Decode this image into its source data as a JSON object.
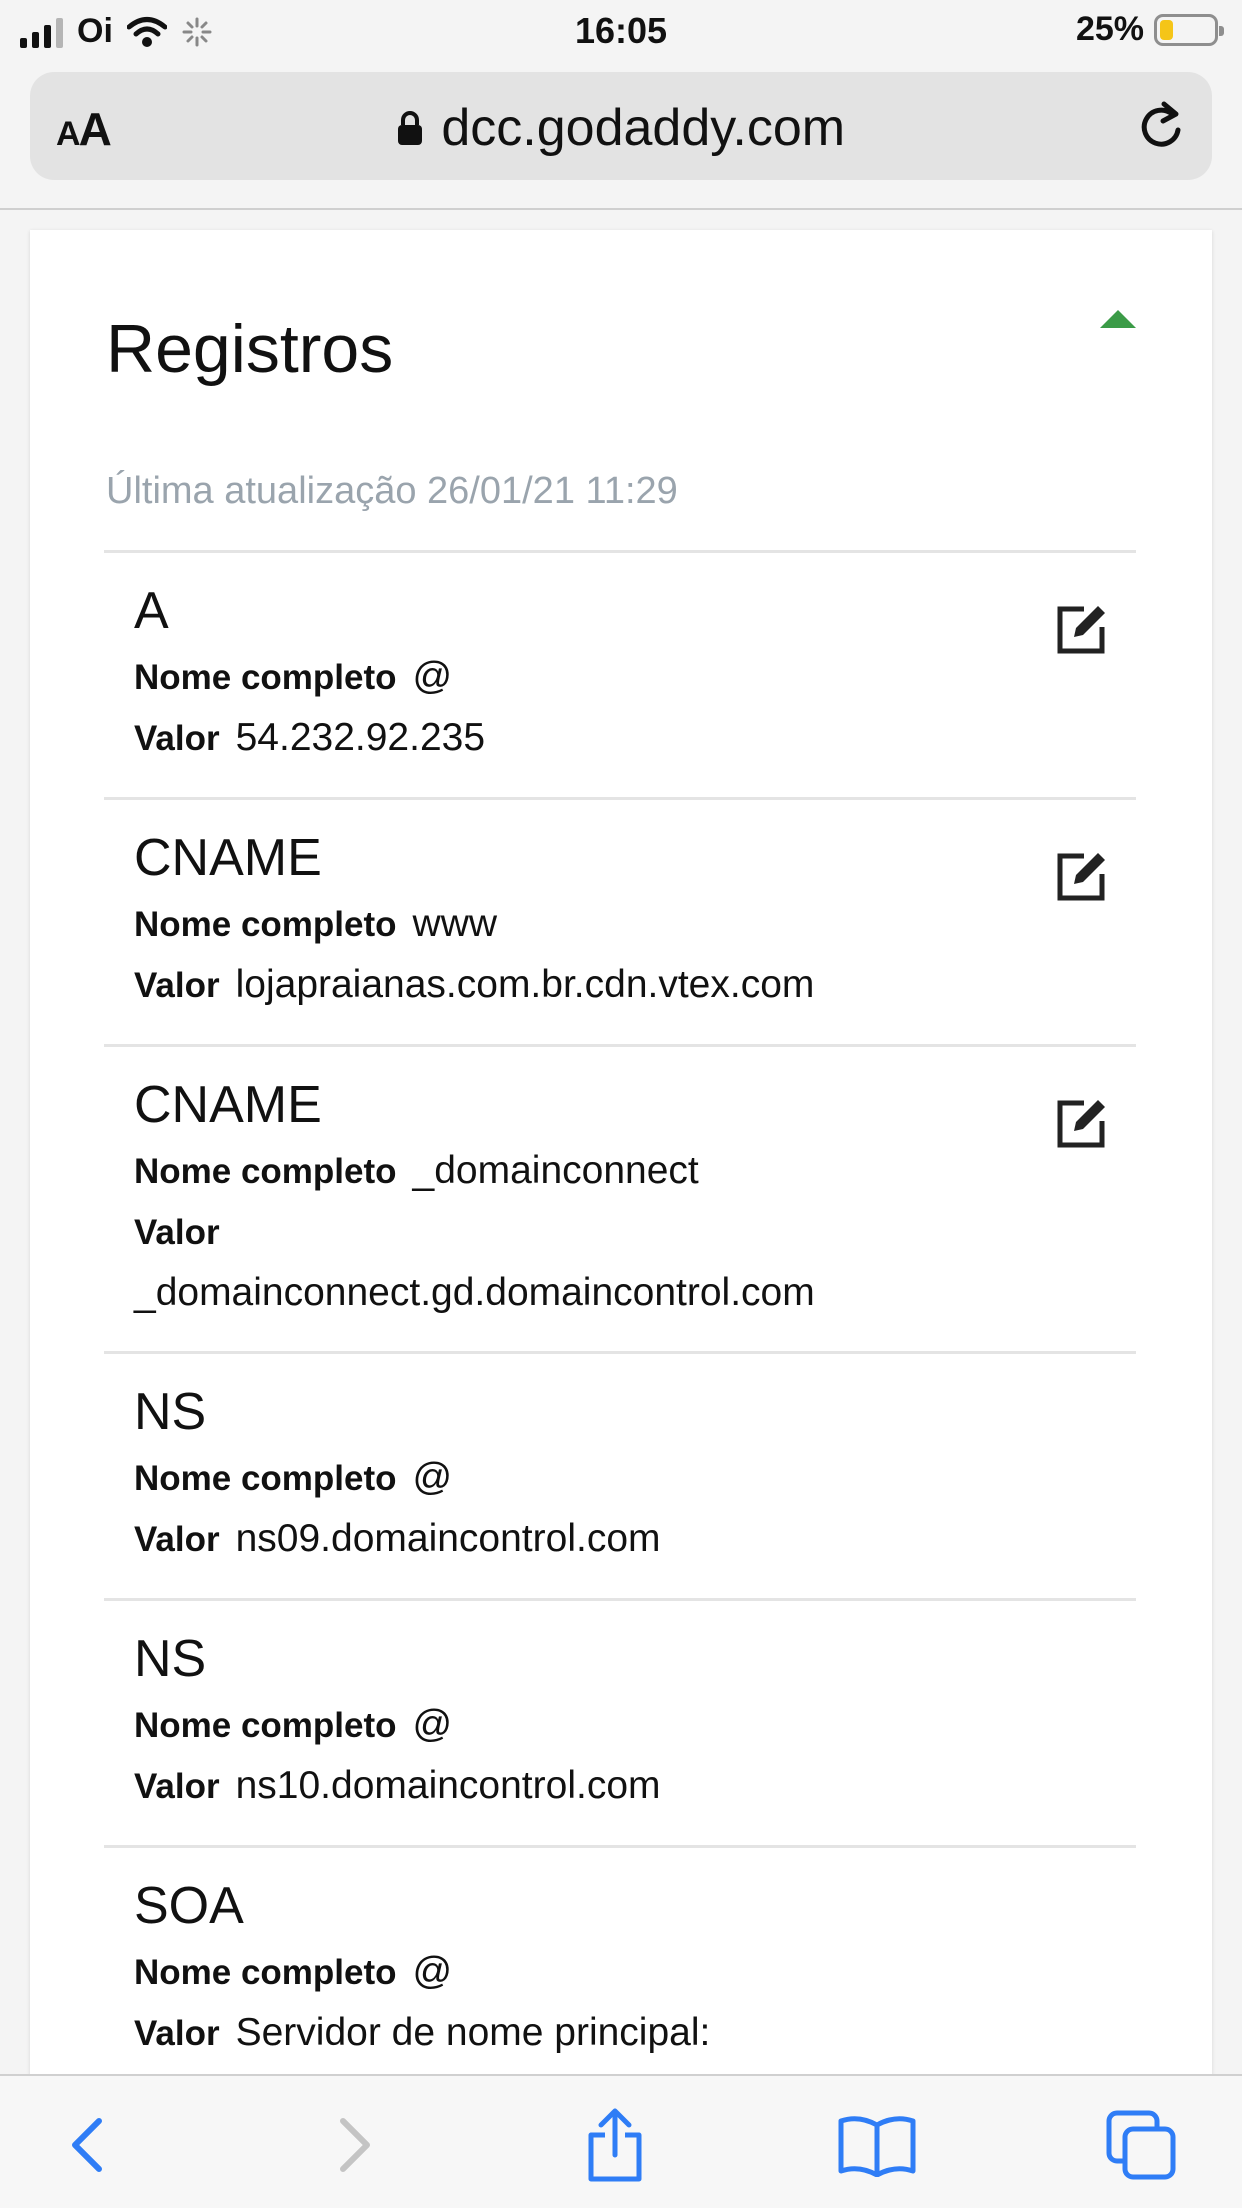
{
  "status_bar": {
    "carrier": "Oi",
    "time": "16:05",
    "battery": "25%",
    "battery_level": 0.25
  },
  "browser": {
    "text_size_label_small": "A",
    "text_size_label_large": "A",
    "url": "dcc.godaddy.com"
  },
  "section": {
    "title": "Registros",
    "updated": "Última atualização 26/01/21 11:29"
  },
  "labels": {
    "full_name": "Nome completo",
    "value": "Valor"
  },
  "records": [
    {
      "type": "A",
      "name": "@",
      "value": "54.232.92.235",
      "editable": true
    },
    {
      "type": "CNAME",
      "name": "www",
      "value": "lojapraianas.com.br.cdn.vtex.com",
      "editable": true
    },
    {
      "type": "CNAME",
      "name": "_domainconnect",
      "value": "_domainconnect.gd.domaincontrol.com",
      "editable": true
    },
    {
      "type": "NS",
      "name": "@",
      "value": "ns09.domaincontrol.com",
      "editable": false
    },
    {
      "type": "NS",
      "name": "@",
      "value": "ns10.domaincontrol.com",
      "editable": false
    },
    {
      "type": "SOA",
      "name": "@",
      "value": "Servidor de nome principal:",
      "editable": false
    }
  ],
  "colors": {
    "accent_green": "#3b9b47",
    "ios_blue": "#2f7df6",
    "muted_text": "#9aa4ad"
  }
}
